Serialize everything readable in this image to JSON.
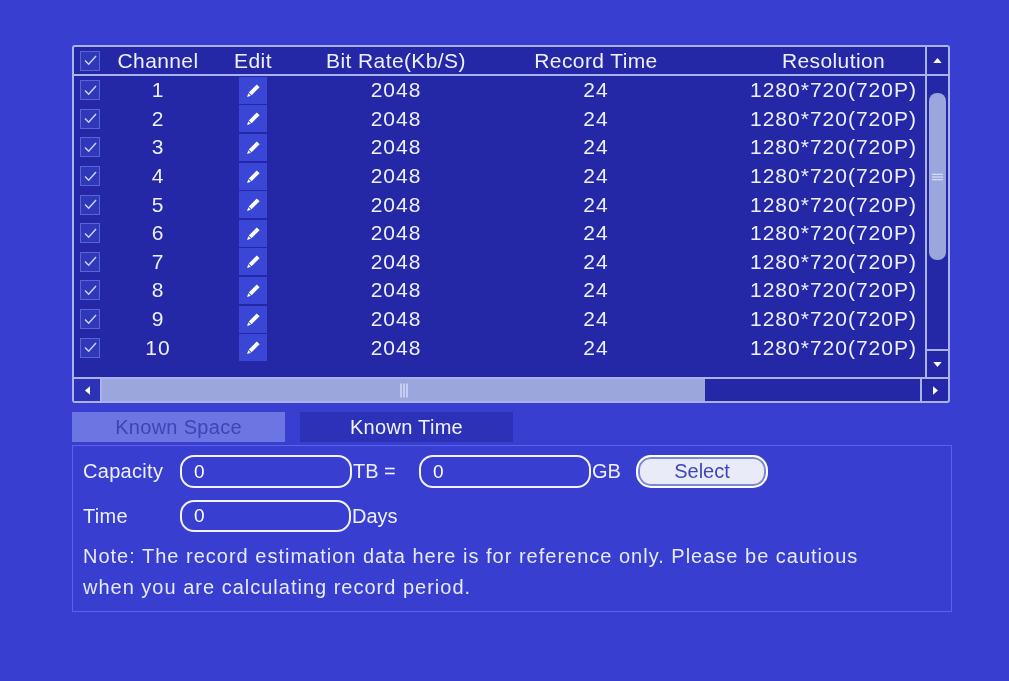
{
  "table": {
    "select_all": {
      "checked": true
    },
    "columns": [
      "Channel",
      "Edit",
      "Bit Rate(Kb/S)",
      "Record Time",
      "Resolution"
    ],
    "rows": [
      {
        "checked": true,
        "channel": "1",
        "bit_rate": "2048",
        "record_time": "24",
        "resolution": "1280*720(720P)"
      },
      {
        "checked": true,
        "channel": "2",
        "bit_rate": "2048",
        "record_time": "24",
        "resolution": "1280*720(720P)"
      },
      {
        "checked": true,
        "channel": "3",
        "bit_rate": "2048",
        "record_time": "24",
        "resolution": "1280*720(720P)"
      },
      {
        "checked": true,
        "channel": "4",
        "bit_rate": "2048",
        "record_time": "24",
        "resolution": "1280*720(720P)"
      },
      {
        "checked": true,
        "channel": "5",
        "bit_rate": "2048",
        "record_time": "24",
        "resolution": "1280*720(720P)"
      },
      {
        "checked": true,
        "channel": "6",
        "bit_rate": "2048",
        "record_time": "24",
        "resolution": "1280*720(720P)"
      },
      {
        "checked": true,
        "channel": "7",
        "bit_rate": "2048",
        "record_time": "24",
        "resolution": "1280*720(720P)"
      },
      {
        "checked": true,
        "channel": "8",
        "bit_rate": "2048",
        "record_time": "24",
        "resolution": "1280*720(720P)"
      },
      {
        "checked": true,
        "channel": "9",
        "bit_rate": "2048",
        "record_time": "24",
        "resolution": "1280*720(720P)"
      },
      {
        "checked": true,
        "channel": "10",
        "bit_rate": "2048",
        "record_time": "24",
        "resolution": "1280*720(720P)"
      }
    ]
  },
  "tabs": [
    {
      "label": "Known Space",
      "selected": false
    },
    {
      "label": "Known Time",
      "selected": true
    }
  ],
  "form": {
    "capacity_label": "Capacity",
    "capacity_tb": {
      "value": "0"
    },
    "tb_unit": "TB =",
    "capacity_gb": {
      "value": "0"
    },
    "gb_unit": "GB",
    "select_button": "Select",
    "time_label": "Time",
    "time": {
      "value": "0"
    },
    "days_unit": "Days",
    "note": "Note: The record estimation data here is for reference only. Please be cautious when you are calculating record period."
  }
}
